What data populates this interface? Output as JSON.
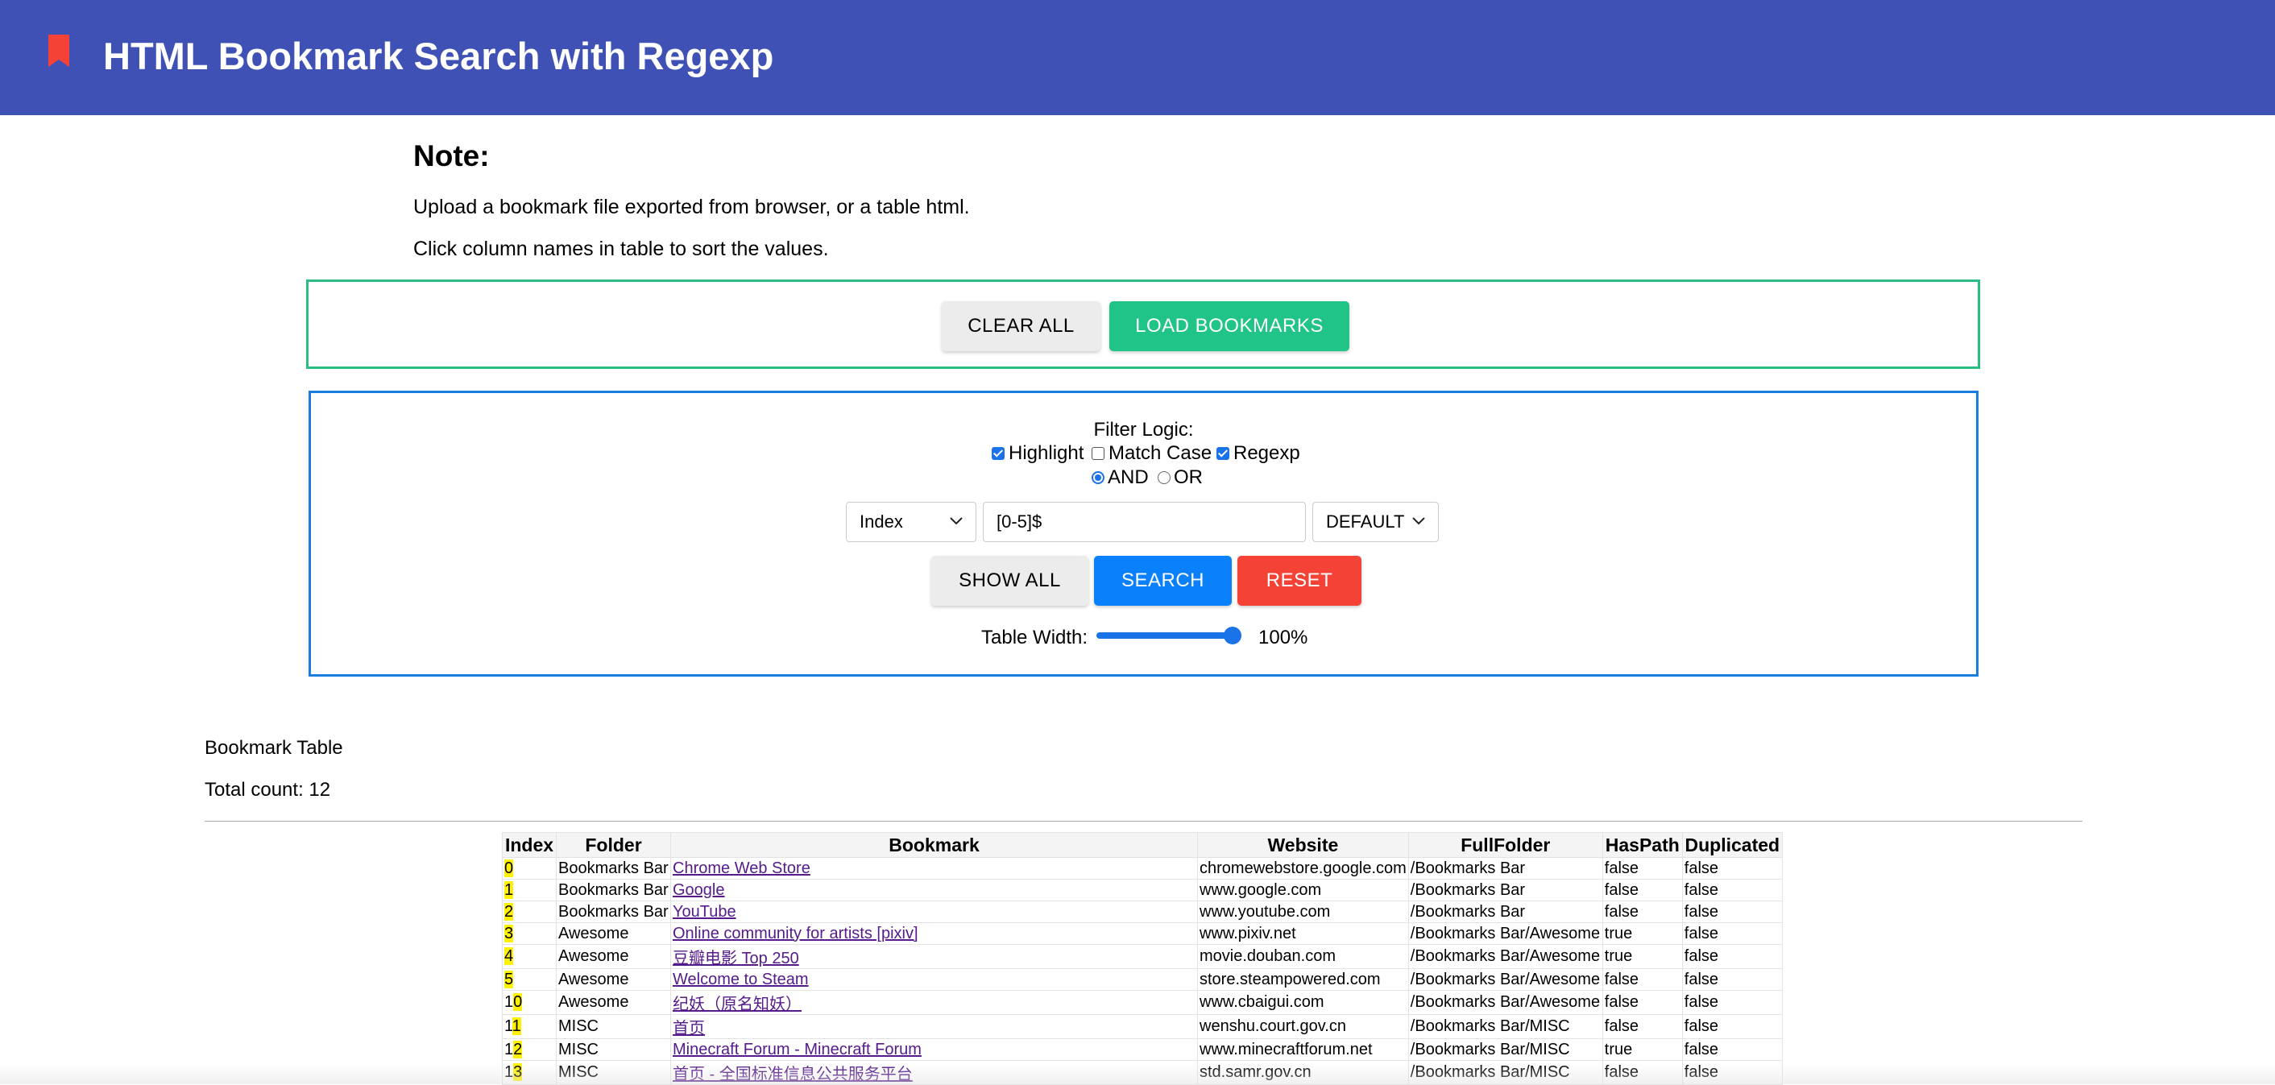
{
  "header": {
    "title": "HTML Bookmark Search with Regexp",
    "color": "#3f51b5",
    "icon": "bookmark-icon",
    "icon_color": "#f44336"
  },
  "note": {
    "heading": "Note:",
    "line1": "Upload a bookmark file exported from browser, or a table html.",
    "line2": "Click column names in table to sort the values."
  },
  "load_panel": {
    "clear_all_label": "CLEAR ALL",
    "load_bookmarks_label": "LOAD BOOKMARKS"
  },
  "filter_panel": {
    "logic_label": "Filter Logic:",
    "highlight": {
      "label": "Highlight",
      "checked": true
    },
    "match_case": {
      "label": "Match Case",
      "checked": false
    },
    "regexp": {
      "label": "Regexp",
      "checked": true
    },
    "and": {
      "label": "AND",
      "selected": true
    },
    "or": {
      "label": "OR",
      "selected": false
    },
    "column_select": "Index",
    "pattern_input": "[0-5]$",
    "mode_select": "DEFAULT",
    "show_all_label": "SHOW ALL",
    "search_label": "SEARCH",
    "reset_label": "RESET",
    "table_width_label": "Table Width:",
    "table_width_value": "100%"
  },
  "table_section": {
    "title": "Bookmark Table",
    "total_count": "Total count: 12",
    "columns": [
      "Index",
      "Folder",
      "Bookmark",
      "Website",
      "FullFolder",
      "HasPath",
      "Duplicated"
    ],
    "rows": [
      {
        "index_prefix": "",
        "index_match": "0",
        "folder": "Bookmarks Bar",
        "bookmark": "Chrome Web Store",
        "website": "chromewebstore.google.com",
        "full_folder": "/Bookmarks Bar",
        "has_path": "false",
        "duplicated": "false"
      },
      {
        "index_prefix": "",
        "index_match": "1",
        "folder": "Bookmarks Bar",
        "bookmark": "Google",
        "website": "www.google.com",
        "full_folder": "/Bookmarks Bar",
        "has_path": "false",
        "duplicated": "false"
      },
      {
        "index_prefix": "",
        "index_match": "2",
        "folder": "Bookmarks Bar",
        "bookmark": "YouTube",
        "website": "www.youtube.com",
        "full_folder": "/Bookmarks Bar",
        "has_path": "false",
        "duplicated": "false"
      },
      {
        "index_prefix": "",
        "index_match": "3",
        "folder": "Awesome",
        "bookmark": "Online community for artists [pixiv]",
        "website": "www.pixiv.net",
        "full_folder": "/Bookmarks Bar/Awesome",
        "has_path": "true",
        "duplicated": "false"
      },
      {
        "index_prefix": "",
        "index_match": "4",
        "folder": "Awesome",
        "bookmark": "豆瓣电影 Top 250",
        "website": "movie.douban.com",
        "full_folder": "/Bookmarks Bar/Awesome",
        "has_path": "true",
        "duplicated": "false"
      },
      {
        "index_prefix": "",
        "index_match": "5",
        "folder": "Awesome",
        "bookmark": "Welcome to Steam",
        "website": "store.steampowered.com",
        "full_folder": "/Bookmarks Bar/Awesome",
        "has_path": "false",
        "duplicated": "false"
      },
      {
        "index_prefix": "1",
        "index_match": "0",
        "folder": "Awesome",
        "bookmark": "纪妖（原名知妖）",
        "website": "www.cbaigui.com",
        "full_folder": "/Bookmarks Bar/Awesome",
        "has_path": "false",
        "duplicated": "false"
      },
      {
        "index_prefix": "1",
        "index_match": "1",
        "folder": "MISC",
        "bookmark": "首页",
        "website": "wenshu.court.gov.cn",
        "full_folder": "/Bookmarks Bar/MISC",
        "has_path": "false",
        "duplicated": "false"
      },
      {
        "index_prefix": "1",
        "index_match": "2",
        "folder": "MISC",
        "bookmark": "Minecraft Forum - Minecraft Forum",
        "website": "www.minecraftforum.net",
        "full_folder": "/Bookmarks Bar/MISC",
        "has_path": "true",
        "duplicated": "false"
      },
      {
        "index_prefix": "1",
        "index_match": "3",
        "folder": "MISC",
        "bookmark": "首页 - 全国标准信息公共服务平台",
        "website": "std.samr.gov.cn",
        "full_folder": "/Bookmarks Bar/MISC",
        "has_path": "false",
        "duplicated": "false"
      }
    ]
  }
}
